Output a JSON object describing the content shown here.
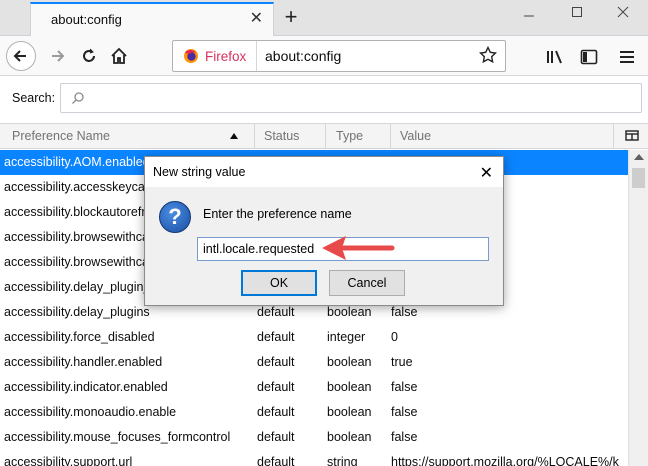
{
  "tab": {
    "title": "about:config",
    "close": "✕"
  },
  "newtab": "+",
  "window": {
    "minimize": "—",
    "maximize": "☐",
    "close": "✕"
  },
  "urlbar": {
    "identity_label": "Firefox",
    "url": "about:config"
  },
  "search": {
    "label": "Search:",
    "value": ""
  },
  "columns": {
    "name": "Preference Name",
    "status": "Status",
    "type": "Type",
    "value": "Value"
  },
  "rows": [
    {
      "name": "accessibility.AOM.enabled",
      "status": "",
      "type": "",
      "value": ""
    },
    {
      "name": "accessibility.accesskeycau",
      "status": "",
      "type": "",
      "value": ""
    },
    {
      "name": "accessibility.blockautorefr",
      "status": "",
      "type": "",
      "value": ""
    },
    {
      "name": "accessibility.browsewithca",
      "status": "",
      "type": "",
      "value": ""
    },
    {
      "name": "accessibility.browsewithca",
      "status": "",
      "type": "",
      "value": ""
    },
    {
      "name": "accessibility.delay_plugin_",
      "status": "",
      "type": "",
      "value": ""
    },
    {
      "name": "accessibility.delay_plugins",
      "status": "default",
      "type": "boolean",
      "value": "false"
    },
    {
      "name": "accessibility.force_disabled",
      "status": "default",
      "type": "integer",
      "value": "0"
    },
    {
      "name": "accessibility.handler.enabled",
      "status": "default",
      "type": "boolean",
      "value": "true"
    },
    {
      "name": "accessibility.indicator.enabled",
      "status": "default",
      "type": "boolean",
      "value": "false"
    },
    {
      "name": "accessibility.monoaudio.enable",
      "status": "default",
      "type": "boolean",
      "value": "false"
    },
    {
      "name": "accessibility.mouse_focuses_formcontrol",
      "status": "default",
      "type": "boolean",
      "value": "false"
    },
    {
      "name": "accessibility.support.url",
      "status": "default",
      "type": "string",
      "value": "https://support.mozilla.org/%LOCALE%/k"
    }
  ],
  "dialog": {
    "title": "New string value",
    "close": "✕",
    "prompt": "Enter the preference name",
    "input_value": "intl.locale.requested",
    "ok_label": "OK",
    "cancel_label": "Cancel"
  },
  "colors": {
    "accent": "#0a84ff",
    "annotation_arrow": "#e84a4a",
    "firefox_label": "#d6335f"
  }
}
